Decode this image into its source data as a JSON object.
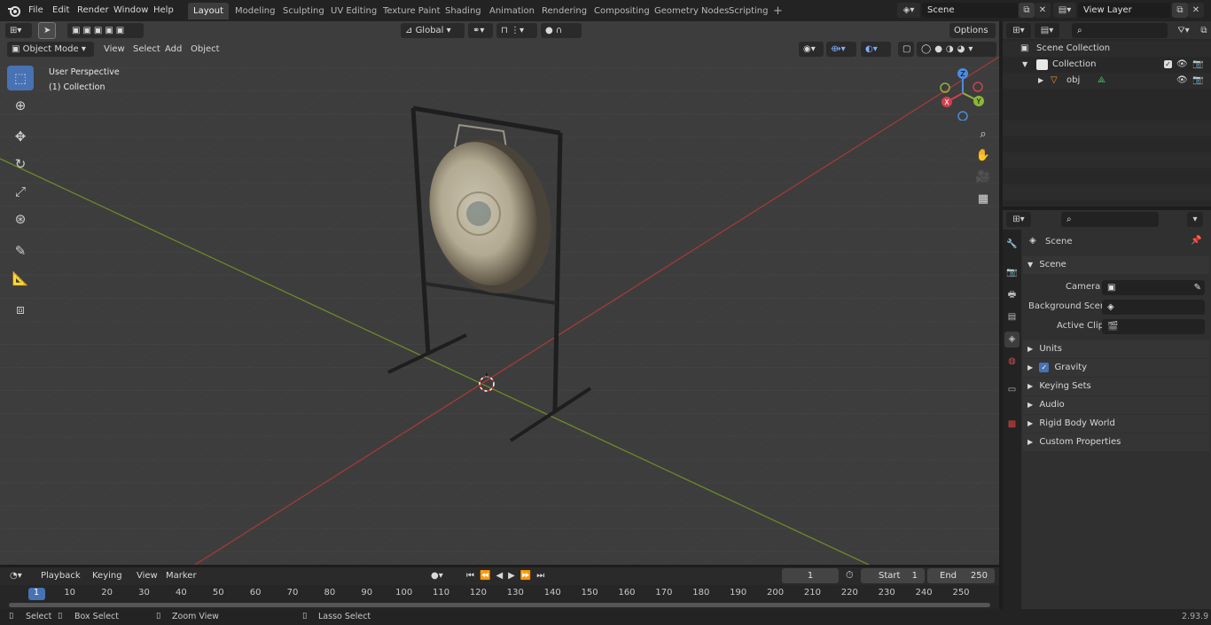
{
  "menubar": {
    "items": [
      "File",
      "Edit",
      "Render",
      "Window",
      "Help"
    ]
  },
  "workspaces": [
    "Layout",
    "Modeling",
    "Sculpting",
    "UV Editing",
    "Texture Paint",
    "Shading",
    "Animation",
    "Rendering",
    "Compositing",
    "Geometry Nodes",
    "Scripting"
  ],
  "scene_field": "Scene",
  "view_layer_field": "View Layer",
  "viewport_header": {
    "mode": "Object Mode",
    "menus": [
      "View",
      "Select",
      "Add",
      "Object"
    ],
    "transform_orientation": "Global",
    "options": "Options"
  },
  "viewport_overlay": {
    "perspective": "User Perspective",
    "collection": "(1) Collection"
  },
  "gizmo": {
    "z": "Z",
    "y": "Y",
    "x": "X"
  },
  "outliner": {
    "scene_collection": "Scene Collection",
    "collection": "Collection",
    "object": "obj"
  },
  "properties": {
    "context": "Scene",
    "section": "Scene",
    "camera_label": "Camera",
    "background_label": "Background Scene",
    "clip_label": "Active Clip",
    "panels": [
      "Units",
      "Gravity",
      "Keying Sets",
      "Audio",
      "Rigid Body World",
      "Custom Properties"
    ]
  },
  "timeline": {
    "menus": [
      "Playback",
      "Keying",
      "View",
      "Marker"
    ],
    "current_frame": "1",
    "start_label": "Start",
    "start_value": "1",
    "end_label": "End",
    "end_value": "250",
    "ruler": [
      "1",
      "10",
      "20",
      "30",
      "40",
      "50",
      "60",
      "70",
      "80",
      "90",
      "100",
      "110",
      "120",
      "130",
      "140",
      "150",
      "160",
      "170",
      "180",
      "190",
      "200",
      "210",
      "220",
      "230",
      "240",
      "250"
    ]
  },
  "statusbar": {
    "select": "Select",
    "box_select": "Box Select",
    "zoom_view": "Zoom View",
    "lasso_select": "Lasso Select",
    "version": "2.93.9"
  }
}
